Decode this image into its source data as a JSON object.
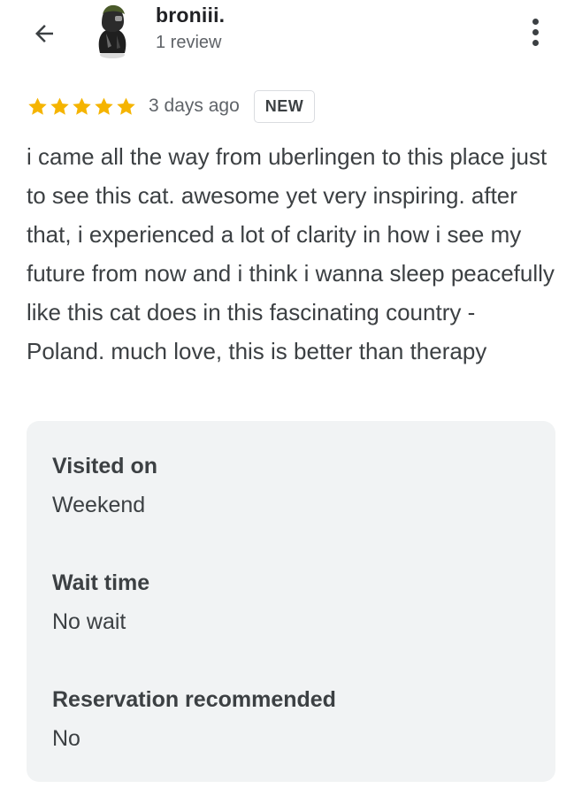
{
  "header": {
    "back_icon": "arrow-left-icon",
    "avatar_icon": "user-avatar",
    "user_name": "broniii.",
    "user_meta": "1 review",
    "more_icon": "more-vertical-icon"
  },
  "review": {
    "rating": 5,
    "rating_max": 5,
    "star_color": "#f5b400",
    "age": "3 days ago",
    "badge": "NEW",
    "text": "i came all the way from uberlingen to this place just to see this cat. awesome yet very inspiring. after that, i experienced a lot of clarity in how i see my future from now and i think i wanna sleep peacefully like this cat does in this fascinating country - Poland. much love, this is better than therapy"
  },
  "details": [
    {
      "label": "Visited on",
      "value": "Weekend"
    },
    {
      "label": "Wait time",
      "value": "No wait"
    },
    {
      "label": "Reservation recommended",
      "value": "No"
    }
  ]
}
